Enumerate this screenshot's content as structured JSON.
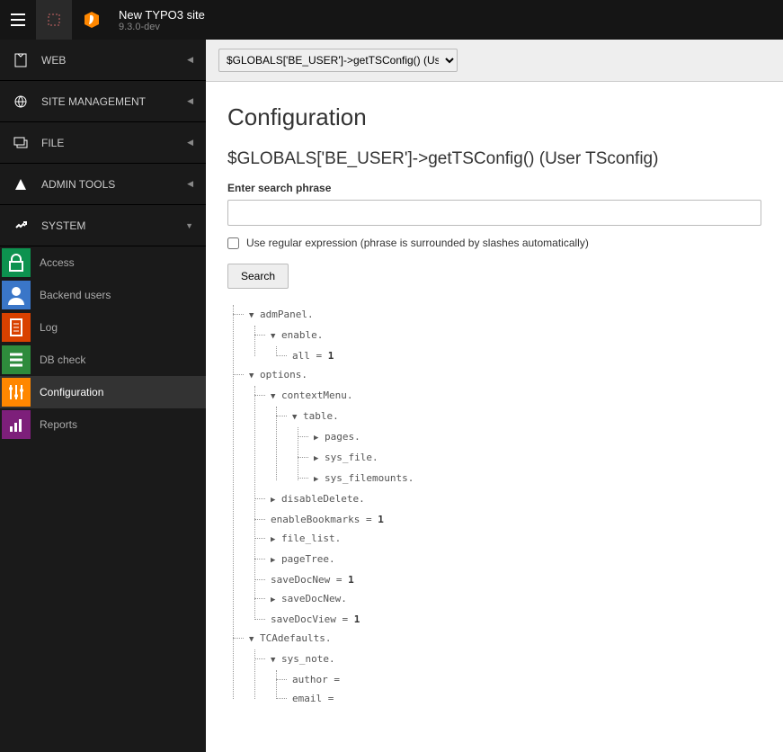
{
  "site": {
    "title": "New TYPO3 site",
    "version": "9.3.0-dev"
  },
  "modules": [
    {
      "id": "web",
      "label": "WEB",
      "expanded": false
    },
    {
      "id": "site",
      "label": "SITE MANAGEMENT",
      "expanded": false
    },
    {
      "id": "file",
      "label": "FILE",
      "expanded": false
    },
    {
      "id": "admin",
      "label": "ADMIN TOOLS",
      "expanded": false
    },
    {
      "id": "system",
      "label": "SYSTEM",
      "expanded": true
    }
  ],
  "system_items": [
    {
      "id": "access",
      "label": "Access",
      "color": "#0d924f"
    },
    {
      "id": "beusers",
      "label": "Backend users",
      "color": "#3a76c8"
    },
    {
      "id": "log",
      "label": "Log",
      "color": "#d94100"
    },
    {
      "id": "dbcheck",
      "label": "DB check",
      "color": "#2e8b3c"
    },
    {
      "id": "configuration",
      "label": "Configuration",
      "color": "#ff8700",
      "active": true
    },
    {
      "id": "reports",
      "label": "Reports",
      "color": "#7d1f7a"
    }
  ],
  "page": {
    "selector": "$GLOBALS['BE_USER']->getTSConfig() (User TSconfig)",
    "heading": "Configuration",
    "subheading": "$GLOBALS['BE_USER']->getTSConfig() (User TSconfig)",
    "search_label": "Enter search phrase",
    "regex_label": "Use regular expression (phrase is surrounded by slashes automatically)",
    "search_button": "Search"
  },
  "tree": {
    "admPanel": {
      "_open": true,
      "enable": {
        "_open": true,
        "all": "1"
      }
    },
    "options": {
      "_open": true,
      "contextMenu": {
        "_open": true,
        "table": {
          "_open": true,
          "pages": {
            "_closed": true
          },
          "sys_file": {
            "_closed": true
          },
          "sys_filemounts": {
            "_closed": true
          }
        }
      },
      "disableDelete": {
        "_closed": true
      },
      "enableBookmarks": "1",
      "file_list": {
        "_closed": true
      },
      "pageTree": {
        "_closed": true
      },
      "saveDocNew": "1",
      "saveDocNew.": {
        "_closed": true
      },
      "saveDocView": "1"
    },
    "TCAdefaults": {
      "_open": true,
      "sys_note": {
        "_open": true,
        "author": "",
        "email": ""
      }
    }
  }
}
